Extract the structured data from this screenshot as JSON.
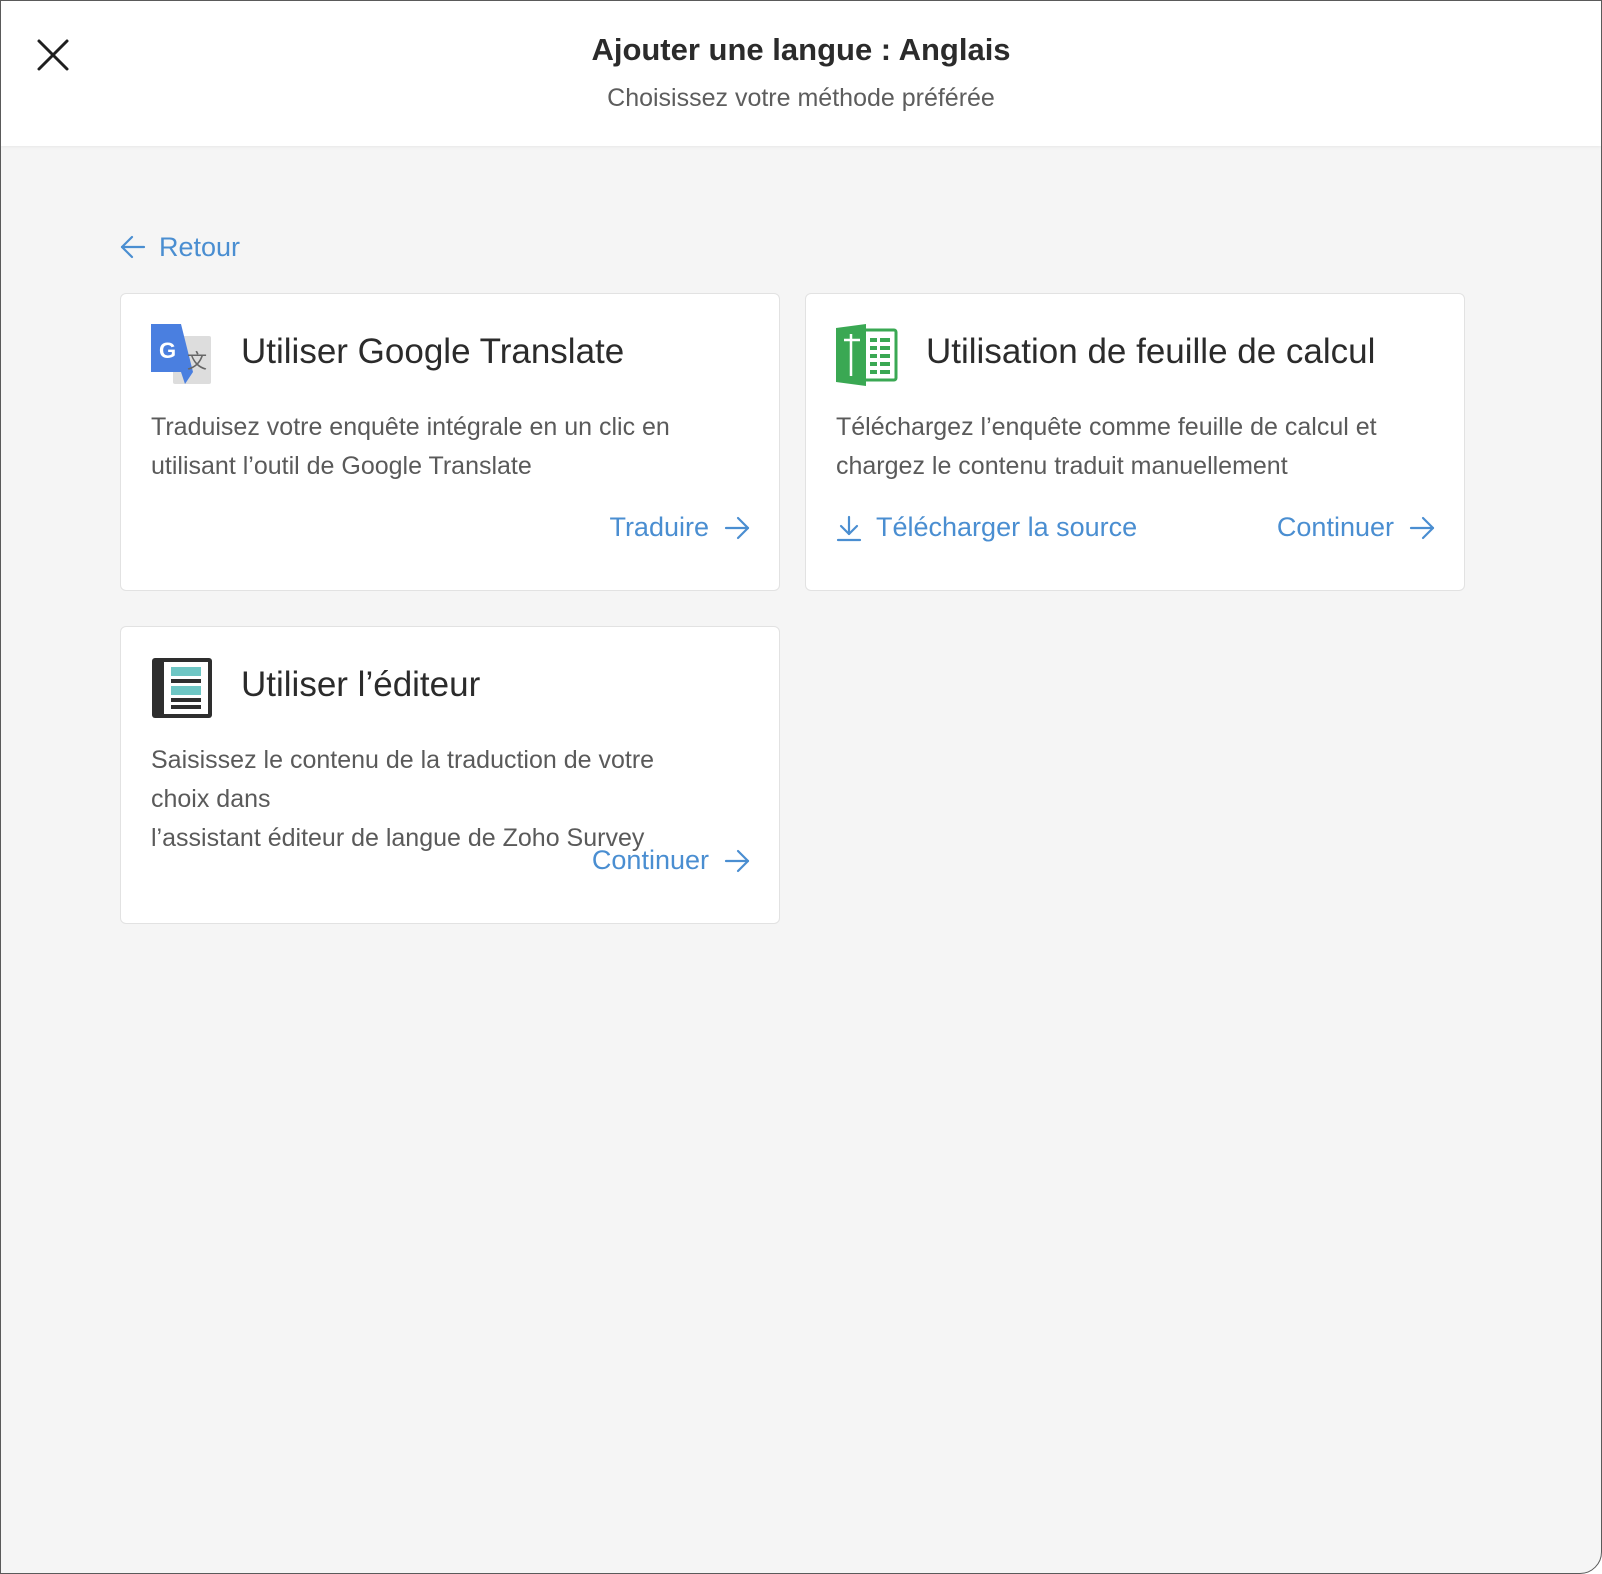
{
  "header": {
    "title": "Ajouter une langue : Anglais",
    "subtitle": "Choisissez votre méthode préférée"
  },
  "nav": {
    "back_label": "Retour"
  },
  "colors": {
    "accent": "#4a8ed1",
    "google_blue": "#4a7fe0",
    "sheet_green": "#3aa853",
    "editor_teal": "#6ec6c4"
  },
  "cards": [
    {
      "icon": "google-translate-icon",
      "title": "Utiliser Google Translate",
      "description": [
        "Traduisez votre enquête intégrale en un clic en",
        "utilisant l’outil de Google Translate"
      ],
      "action_label": "Traduire"
    },
    {
      "icon": "spreadsheet-icon",
      "title": "Utilisation de feuille de calcul",
      "description": [
        "Téléchargez l’enquête comme feuille de calcul et",
        "chargez le contenu traduit manuellement"
      ],
      "download_label": "Télécharger la source",
      "action_label": "Continuer"
    },
    {
      "icon": "editor-icon",
      "title": "Utiliser l’éditeur",
      "description": [
        "Saisissez le contenu de la traduction de votre",
        "choix dans",
        "l’assistant éditeur de langue de Zoho Survey"
      ],
      "action_label": "Continuer"
    }
  ]
}
